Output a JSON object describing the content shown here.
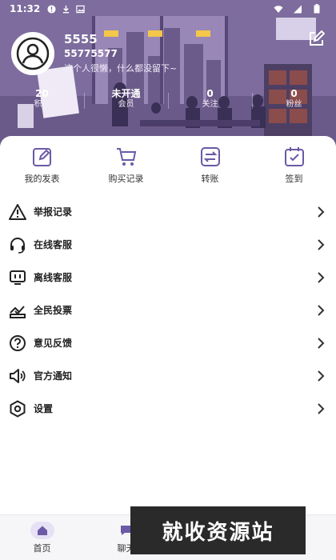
{
  "status": {
    "time": "11:32"
  },
  "profile": {
    "username": "5555",
    "user_id": "55775577",
    "bio": "这个人很懒，什么都没留下~"
  },
  "stats": [
    {
      "value": "20",
      "label": "积分"
    },
    {
      "value": "未开通",
      "label": "会员"
    },
    {
      "value": "0",
      "label": "关注"
    },
    {
      "value": "0",
      "label": "粉丝"
    }
  ],
  "quick_actions": [
    {
      "label": "我的发表",
      "icon": "edit-square-icon"
    },
    {
      "label": "购买记录",
      "icon": "cart-icon"
    },
    {
      "label": "转账",
      "icon": "transfer-icon"
    },
    {
      "label": "签到",
      "icon": "calendar-check-icon"
    }
  ],
  "menu": [
    {
      "label": "举报记录",
      "icon": "warning-icon"
    },
    {
      "label": "在线客服",
      "icon": "headset-icon"
    },
    {
      "label": "离线客服",
      "icon": "monitor-icon"
    },
    {
      "label": "全民投票",
      "icon": "vote-icon"
    },
    {
      "label": "意见反馈",
      "icon": "question-icon"
    },
    {
      "label": "官方通知",
      "icon": "speaker-icon"
    },
    {
      "label": "设置",
      "icon": "settings-icon"
    }
  ],
  "tabbar": [
    {
      "label": "首页",
      "icon": "home-icon"
    },
    {
      "label": "聊天",
      "icon": "chat-icon"
    }
  ],
  "watermark": "就收资源站",
  "colors": {
    "accent": "#6b5aa6",
    "header": "#7b6a9b"
  }
}
